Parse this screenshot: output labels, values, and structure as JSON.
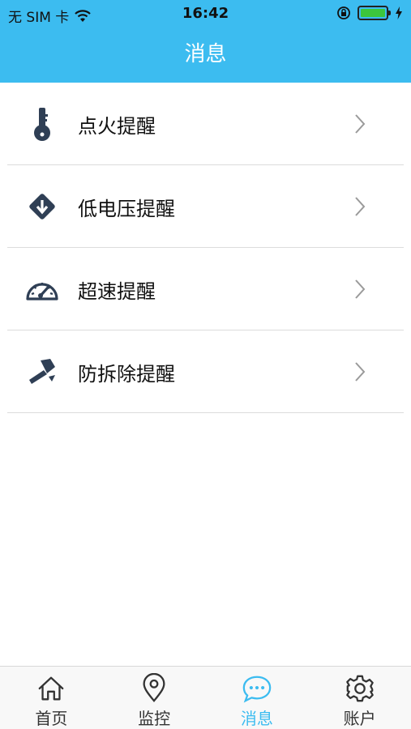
{
  "status_bar": {
    "carrier": "无 SIM 卡",
    "time": "16:42",
    "icons": [
      "wifi-icon",
      "orientation-lock-icon",
      "battery-icon",
      "charging-icon"
    ]
  },
  "header": {
    "title": "消息"
  },
  "list": {
    "items": [
      {
        "label": "点火提醒",
        "icon": "key-icon"
      },
      {
        "label": "低电压提醒",
        "icon": "voltage-down-icon"
      },
      {
        "label": "超速提醒",
        "icon": "speedometer-icon"
      },
      {
        "label": "防拆除提醒",
        "icon": "hammer-icon"
      }
    ]
  },
  "tabbar": {
    "active": "消息",
    "items": [
      {
        "label": "首页",
        "icon": "home-icon"
      },
      {
        "label": "监控",
        "icon": "location-pin-icon"
      },
      {
        "label": "消息",
        "icon": "chat-bubble-icon"
      },
      {
        "label": "账户",
        "icon": "gear-icon"
      }
    ]
  },
  "colors": {
    "accent": "#3cbcf0",
    "icon_dark": "#2f3f55",
    "battery": "#3cc63c"
  }
}
